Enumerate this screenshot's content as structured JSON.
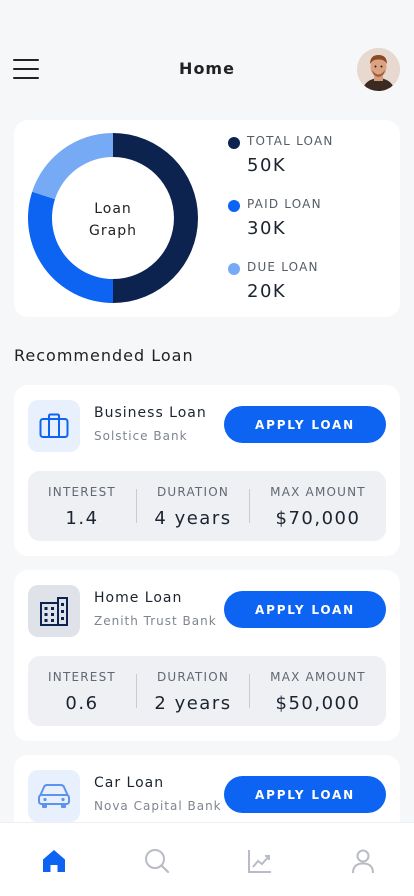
{
  "header": {
    "title": "Home"
  },
  "summary": {
    "graph_label_line1": "Loan",
    "graph_label_line2": "Graph",
    "legend": [
      {
        "name": "TOTAL LOAN",
        "value": "50K",
        "color": "#0c2350"
      },
      {
        "name": "PAID LOAN",
        "value": "30K",
        "color": "#0d63f2"
      },
      {
        "name": "DUE LOAN",
        "value": "20K",
        "color": "#77aaf5"
      }
    ]
  },
  "chart_data": {
    "type": "pie",
    "labels": [
      "TOTAL LOAN",
      "PAID LOAN",
      "DUE LOAN"
    ],
    "values": [
      50,
      30,
      20
    ],
    "colors": [
      "#0c2350",
      "#0d63f2",
      "#77aaf5"
    ]
  },
  "recommended": {
    "title": "Recommended Loan",
    "apply_label": "APPLY LOAN",
    "stat_labels": {
      "interest": "INTEREST",
      "duration": "DURATION",
      "max_amount": "MAX AMOUNT"
    },
    "loans": [
      {
        "name": "Business Loan",
        "bank": "Solstice Bank",
        "interest": "1.4",
        "duration": "4 years",
        "max_amount": "$70,000",
        "icon": "briefcase-icon"
      },
      {
        "name": "Home Loan",
        "bank": "Zenith Trust Bank",
        "interest": "0.6",
        "duration": "2 years",
        "max_amount": "$50,000",
        "icon": "building-icon"
      },
      {
        "name": "Car Loan",
        "bank": "Nova Capital Bank",
        "icon": "car-icon"
      }
    ]
  },
  "nav": {
    "items": [
      "home-icon",
      "search-icon",
      "chart-icon",
      "profile-icon"
    ],
    "active_color": "#0d63f2",
    "inactive_color": "#b8bcc4"
  }
}
